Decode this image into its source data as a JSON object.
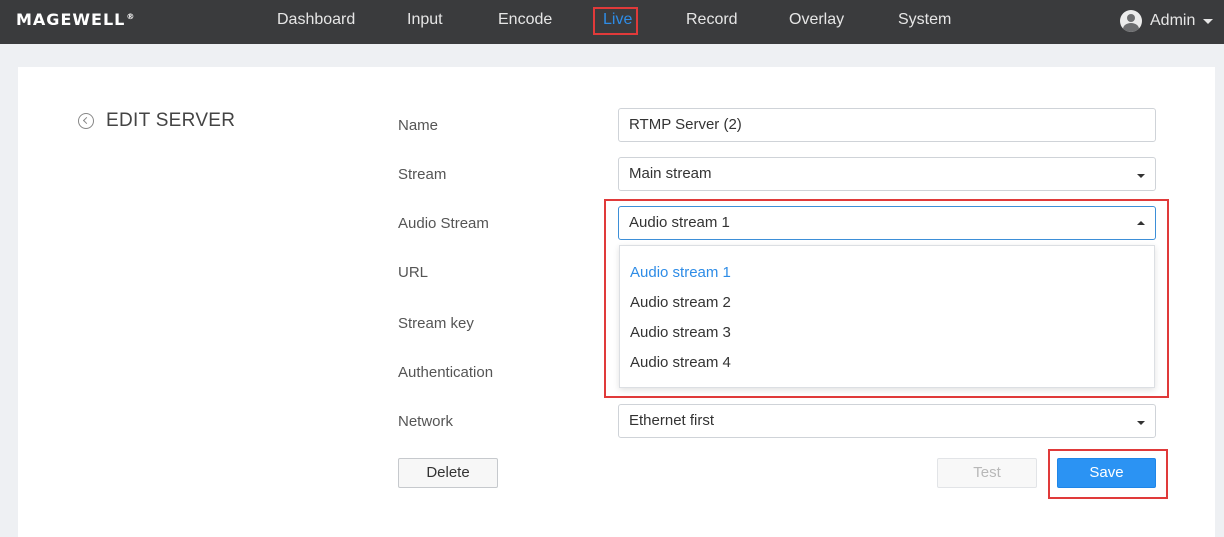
{
  "header": {
    "logo": "MAGEWELL",
    "logo_mark": "®",
    "nav": [
      {
        "label": "Dashboard"
      },
      {
        "label": "Input"
      },
      {
        "label": "Encode"
      },
      {
        "label": "Live"
      },
      {
        "label": "Record"
      },
      {
        "label": "Overlay"
      },
      {
        "label": "System"
      }
    ],
    "active_nav": "Live",
    "user": "Admin"
  },
  "page": {
    "title": "EDIT SERVER"
  },
  "form": {
    "name": {
      "label": "Name",
      "value": "RTMP Server (2)"
    },
    "stream": {
      "label": "Stream",
      "value": "Main stream"
    },
    "audio_stream": {
      "label": "Audio Stream",
      "value": "Audio stream 1",
      "options": [
        "Audio stream 1",
        "Audio stream 2",
        "Audio stream 3",
        "Audio stream 4"
      ]
    },
    "url": {
      "label": "URL"
    },
    "stream_key": {
      "label": "Stream key"
    },
    "authentication": {
      "label": "Authentication"
    },
    "network": {
      "label": "Network",
      "value": "Ethernet first"
    }
  },
  "buttons": {
    "delete": "Delete",
    "test": "Test",
    "save": "Save"
  },
  "colors": {
    "topbar": "#3a3b3d",
    "accent": "#2e8ce6",
    "highlight": "#e03a3a",
    "save": "#2b93f3"
  }
}
